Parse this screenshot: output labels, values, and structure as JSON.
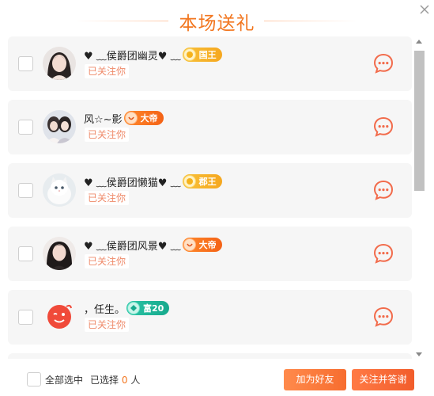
{
  "dialog": {
    "title": "本场送礼"
  },
  "users": [
    {
      "nickname": "♥ ﹏侯爵团幽灵♥ ﹏",
      "badge": "国王",
      "badge_color": "#f6b22b",
      "follow_status": "已关注你"
    },
    {
      "nickname": "风☆~影",
      "badge": "大帝",
      "badge_color": "#f46a1c",
      "follow_status": "已关注你"
    },
    {
      "nickname": "♥ ﹏侯爵团懒猫♥ ﹏",
      "badge": "郡王",
      "badge_color": "#f6b22b",
      "follow_status": "已关注你"
    },
    {
      "nickname": "♥ ﹏侯爵团风景♥ ﹏",
      "badge": "大帝",
      "badge_color": "#f46a1c",
      "follow_status": "已关注你"
    },
    {
      "nickname": "，任生。",
      "badge": "富20",
      "badge_color": "#1fb596",
      "follow_status": "已关注你"
    }
  ],
  "footer": {
    "select_all_label": "全部选中",
    "selected_prefix": "已选择",
    "selected_count": "0",
    "selected_suffix": "人",
    "add_friend_label": "加为好友",
    "follow_thank_label": "关注并答谢"
  },
  "colors": {
    "accent": "#f2761f",
    "follow_text": "#ef8a6a",
    "chat_icon": "#f26b4b"
  },
  "icons": {
    "close": "close-icon",
    "chat": "chat-bubble-icon"
  }
}
